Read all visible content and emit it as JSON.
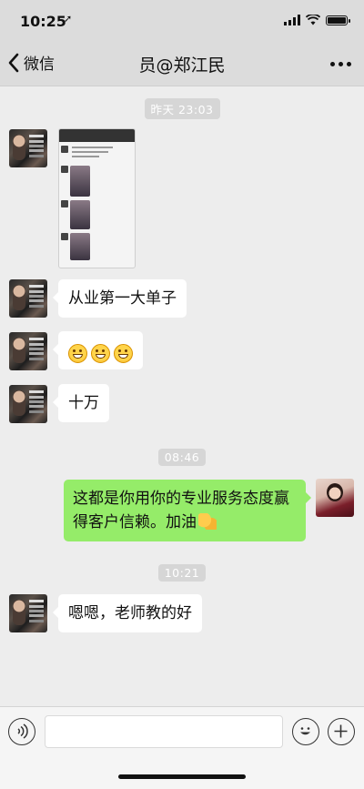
{
  "status": {
    "time": "10:25"
  },
  "nav": {
    "back_label": "微信",
    "title": "员@郑江民"
  },
  "timestamps": {
    "t1": "昨天 23:03",
    "t2": "08:46",
    "t3": "10:21"
  },
  "messages": {
    "m2": "从业第一大单子",
    "m4": "十万",
    "m5": "这都是你用你的专业服务态度赢得客户信赖。加油",
    "m6": "嗯嗯，老师教的好"
  },
  "icons": {
    "back": "chevron-left-icon",
    "more": "more-icon",
    "voice": "voice-icon",
    "emoji": "emoji-icon",
    "plus": "plus-icon"
  },
  "colors": {
    "self_bubble": "#95ec69",
    "background": "#ededed"
  }
}
